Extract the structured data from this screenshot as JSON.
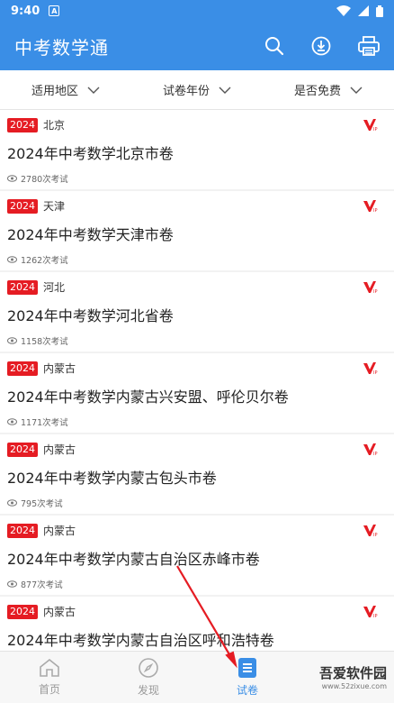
{
  "status": {
    "time": "9:40",
    "badge": "A"
  },
  "appbar": {
    "title": "中考数学通"
  },
  "filters": [
    {
      "label": "适用地区"
    },
    {
      "label": "试卷年份"
    },
    {
      "label": "是否免费"
    }
  ],
  "items": [
    {
      "year": "2024",
      "region": "北京",
      "title": "2024年中考数学北京市卷",
      "views": "2780次考试"
    },
    {
      "year": "2024",
      "region": "天津",
      "title": "2024年中考数学天津市卷",
      "views": "1262次考试"
    },
    {
      "year": "2024",
      "region": "河北",
      "title": "2024年中考数学河北省卷",
      "views": "1158次考试"
    },
    {
      "year": "2024",
      "region": "内蒙古",
      "title": "2024年中考数学内蒙古兴安盟、呼伦贝尔卷",
      "views": "1171次考试"
    },
    {
      "year": "2024",
      "region": "内蒙古",
      "title": "2024年中考数学内蒙古包头市卷",
      "views": "795次考试"
    },
    {
      "year": "2024",
      "region": "内蒙古",
      "title": "2024年中考数学内蒙古自治区赤峰市卷",
      "views": "877次考试"
    },
    {
      "year": "2024",
      "region": "内蒙古",
      "title": "2024年中考数学内蒙古自治区呼和浩特卷",
      "views": ""
    }
  ],
  "nav": [
    {
      "label": "首页",
      "icon": "home-icon",
      "active": false
    },
    {
      "label": "发现",
      "icon": "compass-icon",
      "active": false
    },
    {
      "label": "试卷",
      "icon": "paper-icon",
      "active": true
    }
  ],
  "watermark": {
    "text": "吾爱软件园",
    "sub": "www.52zixue.com"
  },
  "colors": {
    "primary": "#3a8ee6",
    "badge": "#e51c23"
  }
}
